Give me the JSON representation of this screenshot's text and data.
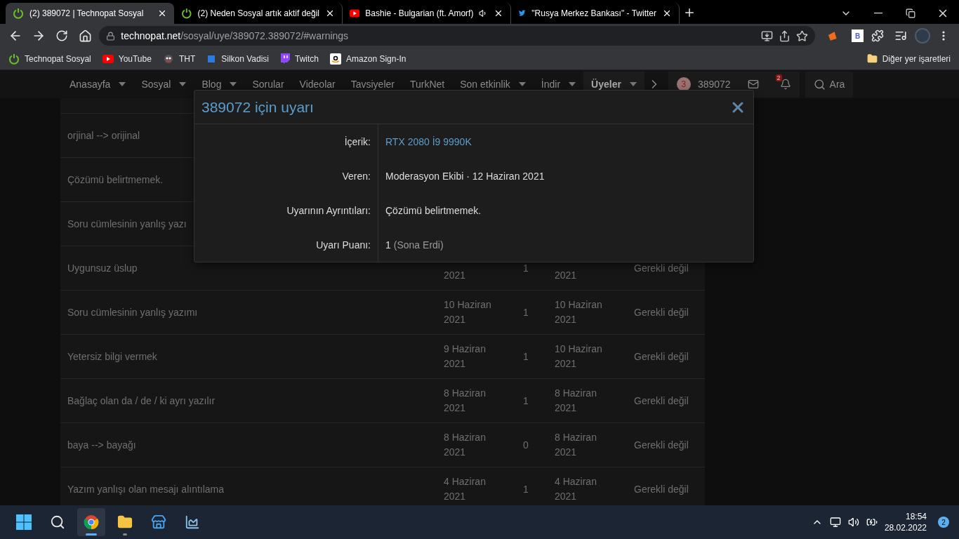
{
  "browser": {
    "tabs": [
      {
        "title": "(2) 389072 | Technopat Sosyal",
        "selected": true,
        "audio": false
      },
      {
        "title": "(2) Neden Sosyal artık aktif değil",
        "selected": false,
        "audio": false
      },
      {
        "title": "Bashie - Bulgarian (ft. Amorf)",
        "selected": false,
        "audio": true
      },
      {
        "title": "\"Rusya Merkez Bankası\" - Twitter",
        "selected": false,
        "audio": false
      }
    ],
    "url_host": "technopat.net",
    "url_path": "/sosyal/uye/389072.389072/#warnings",
    "extension_letter": "B",
    "bookmarks": [
      {
        "label": "Technopat Sosyal"
      },
      {
        "label": "YouTube"
      },
      {
        "label": "THT"
      },
      {
        "label": "Silkon Vadisi"
      },
      {
        "label": "Twitch"
      },
      {
        "label": "Amazon Sign-In"
      }
    ],
    "other_bookmarks": "Diğer yer işaretleri"
  },
  "nav": {
    "items": [
      {
        "label": "Anasayfa",
        "dropdown": true,
        "selected": false
      },
      {
        "label": "Sosyal",
        "dropdown": true,
        "selected": false
      },
      {
        "label": "Blog",
        "dropdown": true,
        "selected": false
      },
      {
        "label": "Sorular",
        "dropdown": false,
        "selected": false
      },
      {
        "label": "Videolar",
        "dropdown": false,
        "selected": false
      },
      {
        "label": "Tavsiyeler",
        "dropdown": false,
        "selected": false
      },
      {
        "label": "TurkNet",
        "dropdown": false,
        "selected": false
      },
      {
        "label": "Son etkinlik",
        "dropdown": true,
        "selected": false
      },
      {
        "label": "İndir",
        "dropdown": true,
        "selected": false
      },
      {
        "label": "Üyeler",
        "dropdown": true,
        "selected": true
      }
    ],
    "user_badge": "3",
    "username": "389072",
    "alerts_badge": "2",
    "search": "Ara"
  },
  "warnings_table": {
    "rows": [
      {
        "reason": ""
      },
      {
        "reason": "orjinal --> orijinal"
      },
      {
        "reason": "Çözümü belirtmemek."
      },
      {
        "reason": "Soru cümlesinin yanlış yazı"
      },
      {
        "reason": "Uygunsuz üslup",
        "date": "2021",
        "points": "1",
        "expiry": "2021",
        "status": "Gerekli değil"
      },
      {
        "reason": "Soru cümlesinin yanlış yazımı",
        "date": "10 Haziran 2021",
        "points": "1",
        "expiry": "10 Haziran 2021",
        "status": "Gerekli değil"
      },
      {
        "reason": "Yetersiz bilgi vermek",
        "date": "9 Haziran 2021",
        "points": "1",
        "expiry": "10 Haziran 2021",
        "status": "Gerekli değil"
      },
      {
        "reason": "Bağlaç olan da / de / ki ayrı yazılır",
        "date": "8 Haziran 2021",
        "points": "1",
        "expiry": "8 Haziran 2021",
        "status": "Gerekli değil"
      },
      {
        "reason": "baya --> bayağı",
        "date": "8 Haziran 2021",
        "points": "0",
        "expiry": "8 Haziran 2021",
        "status": "Gerekli değil"
      },
      {
        "reason": "Yazım yanlışı olan mesajı alıntılama",
        "date": "4 Haziran 2021",
        "points": "1",
        "expiry": "4 Haziran 2021",
        "status": "Gerekli değil"
      }
    ]
  },
  "modal": {
    "title": "389072 için uyarı",
    "fields": [
      {
        "label": "İçerik:",
        "value": "RTX 2080 İ9 9990K",
        "kind": "link"
      },
      {
        "label": "Veren:",
        "value": "Moderasyon Ekibi · 12 Haziran 2021",
        "kind": "text"
      },
      {
        "label": "Uyarının Ayrıntıları:",
        "value": "Çözümü belirtmemek.",
        "kind": "text"
      },
      {
        "label": "Uyarı Puanı:",
        "value": "1",
        "note": "(Sona Erdi)",
        "kind": "points"
      }
    ]
  },
  "taskbar": {
    "apps": [
      {
        "open": true,
        "active": true
      },
      {
        "open": true,
        "active": false
      },
      {
        "open": false,
        "active": false
      },
      {
        "open": false,
        "active": false
      }
    ],
    "time": "18:54",
    "date": "28.02.2022",
    "notifications": "2"
  }
}
